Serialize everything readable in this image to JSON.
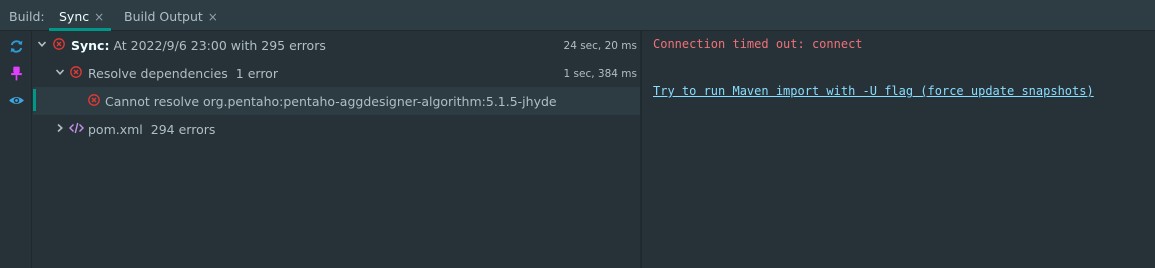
{
  "tabbar": {
    "label": "Build:",
    "tabs": [
      {
        "label": "Sync",
        "active": true,
        "close": "×"
      },
      {
        "label": "Build Output",
        "active": false,
        "close": "×"
      }
    ]
  },
  "toolbar": {
    "buttons": [
      "sync-icon",
      "pin-icon",
      "eye-icon"
    ]
  },
  "tree": {
    "rows": [
      {
        "title": "Sync:",
        "text": " At 2022/9/6 23:00 with 295 errors",
        "time": "24 sec, 20 ms",
        "icon": "error-icon",
        "expanded": true
      },
      {
        "title": "Resolve dependencies",
        "text": "1 error",
        "time": "1 sec, 384 ms",
        "icon": "error-icon",
        "expanded": true
      },
      {
        "title": "Cannot resolve org.pentaho:pentaho-aggdesigner-algorithm:5.1.5-jhyde",
        "icon": "error-icon",
        "selected": true
      },
      {
        "title": "pom.xml",
        "text": "294 errors",
        "icon": "xml-file-icon",
        "expanded": false
      }
    ]
  },
  "console": {
    "error_text": "Connection timed out: connect",
    "link_text": "Try to run Maven import with -U flag (force update snapshots)"
  },
  "colors": {
    "accent": "#009688",
    "error": "#F07178",
    "link": "#89DDFF"
  }
}
